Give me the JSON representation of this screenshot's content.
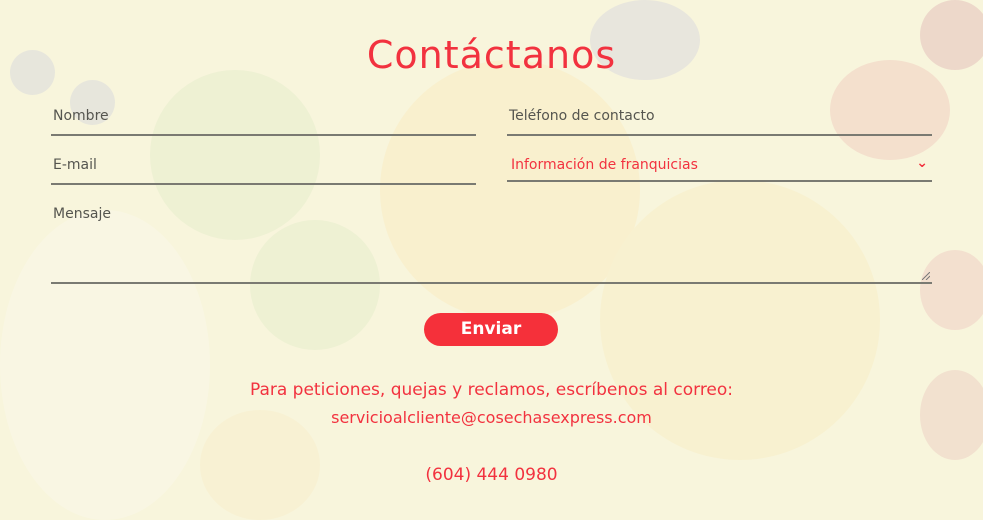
{
  "page": {
    "title": "Contáctanos"
  },
  "form": {
    "name_placeholder": "Nombre",
    "phone_placeholder": "Teléfono de contacto",
    "email_placeholder": "E-mail",
    "subject_selected": "Información de franquicias",
    "message_placeholder": "Mensaje",
    "submit_label": "Enviar"
  },
  "contact": {
    "pqr_text": "Para peticiones, quejas y reclamos, escríbenos al correo:",
    "email": "servicioalcliente@cosechasexpress.com",
    "phone": "(604) 444 0980"
  },
  "colors": {
    "accent": "#f2323f",
    "button": "#f5303a",
    "line": "#7a7a72"
  },
  "icons": {
    "select_arrow": "chevron-down-icon"
  }
}
